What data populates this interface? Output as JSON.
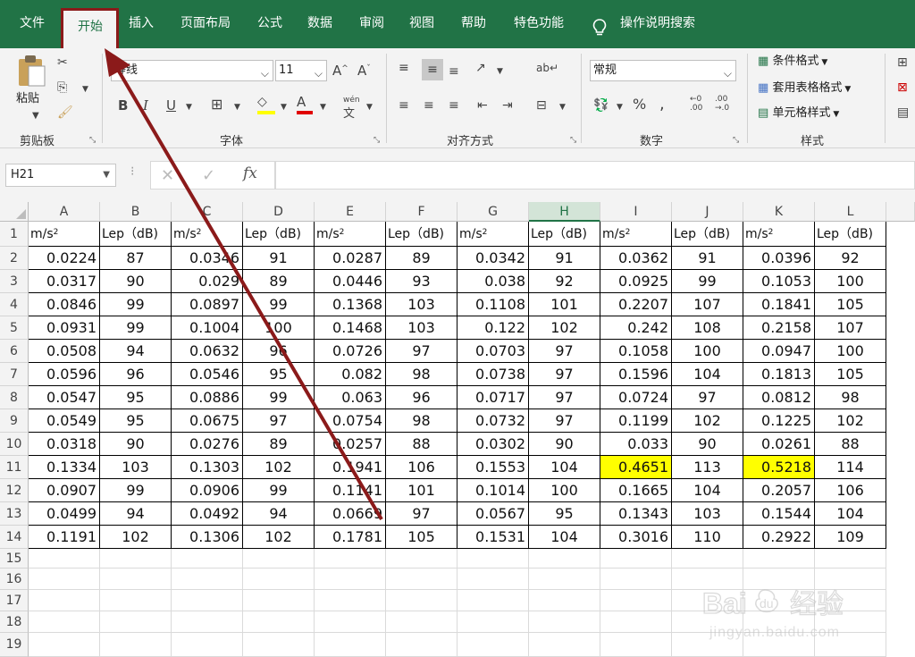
{
  "menu": {
    "items": [
      "文件",
      "开始",
      "插入",
      "页面布局",
      "公式",
      "数据",
      "审阅",
      "视图",
      "帮助",
      "特色功能"
    ],
    "active": "开始",
    "search_label": "操作说明搜索"
  },
  "ribbon": {
    "clipboard": {
      "paste_label": "粘贴",
      "group_label": "剪贴板"
    },
    "font": {
      "font_name": "等线",
      "font_size": "11",
      "bold": "B",
      "italic": "I",
      "underline": "U",
      "phonetic": "wén",
      "group_label": "字体"
    },
    "alignment": {
      "group_label": "对齐方式"
    },
    "number": {
      "format": "常规",
      "group_label": "数字"
    },
    "styles": {
      "conditional": "条件格式",
      "table_format": "套用表格格式",
      "cell_styles": "单元格样式",
      "group_label": "样式"
    }
  },
  "formula_bar": {
    "name_box": "H21",
    "fx": "fx",
    "formula": ""
  },
  "grid": {
    "columns": [
      "A",
      "B",
      "C",
      "D",
      "E",
      "F",
      "G",
      "H",
      "I",
      "J",
      "K",
      "L"
    ],
    "selected_column": "H",
    "rows": [
      "1",
      "2",
      "3",
      "4",
      "5",
      "6",
      "7",
      "8",
      "9",
      "10",
      "11",
      "12",
      "13",
      "14",
      "15",
      "16",
      "17",
      "18",
      "19"
    ],
    "header_accel": "m/s",
    "header_accel_sup": "2",
    "header_lep": "Lep（dB)",
    "data": [
      [
        "0.0224",
        "87",
        "0.0346",
        "91",
        "0.0287",
        "89",
        "0.0342",
        "91",
        "0.0362",
        "91",
        "0.0396",
        "92"
      ],
      [
        "0.0317",
        "90",
        "0.029",
        "89",
        "0.0446",
        "93",
        "0.038",
        "92",
        "0.0925",
        "99",
        "0.1053",
        "100"
      ],
      [
        "0.0846",
        "99",
        "0.0897",
        "99",
        "0.1368",
        "103",
        "0.1108",
        "101",
        "0.2207",
        "107",
        "0.1841",
        "105"
      ],
      [
        "0.0931",
        "99",
        "0.1004",
        "100",
        "0.1468",
        "103",
        "0.122",
        "102",
        "0.242",
        "108",
        "0.2158",
        "107"
      ],
      [
        "0.0508",
        "94",
        "0.0632",
        "96",
        "0.0726",
        "97",
        "0.0703",
        "97",
        "0.1058",
        "100",
        "0.0947",
        "100"
      ],
      [
        "0.0596",
        "96",
        "0.0546",
        "95",
        "0.082",
        "98",
        "0.0738",
        "97",
        "0.1596",
        "104",
        "0.1813",
        "105"
      ],
      [
        "0.0547",
        "95",
        "0.0886",
        "99",
        "0.063",
        "96",
        "0.0717",
        "97",
        "0.0724",
        "97",
        "0.0812",
        "98"
      ],
      [
        "0.0549",
        "95",
        "0.0675",
        "97",
        "0.0754",
        "98",
        "0.0732",
        "97",
        "0.1199",
        "102",
        "0.1225",
        "102"
      ],
      [
        "0.0318",
        "90",
        "0.0276",
        "89",
        "0.0257",
        "88",
        "0.0302",
        "90",
        "0.033",
        "90",
        "0.0261",
        "88"
      ],
      [
        "0.1334",
        "103",
        "0.1303",
        "102",
        "0.1941",
        "106",
        "0.1553",
        "104",
        "0.4651",
        "113",
        "0.5218",
        "114"
      ],
      [
        "0.0907",
        "99",
        "0.0906",
        "99",
        "0.1141",
        "101",
        "0.1014",
        "100",
        "0.1665",
        "104",
        "0.2057",
        "106"
      ],
      [
        "0.0499",
        "94",
        "0.0492",
        "94",
        "0.0669",
        "97",
        "0.0567",
        "95",
        "0.1343",
        "103",
        "0.1544",
        "104"
      ],
      [
        "0.1191",
        "102",
        "0.1306",
        "102",
        "0.1781",
        "105",
        "0.1531",
        "104",
        "0.3016",
        "110",
        "0.2922",
        "109"
      ]
    ],
    "highlighted": [
      {
        "row": "11",
        "col": "I"
      },
      {
        "row": "11",
        "col": "K"
      }
    ]
  },
  "colors": {
    "excel_green": "#217346",
    "highlight": "#ffff00",
    "annotation": "#8b1a1a"
  },
  "watermark": {
    "brand": "Baidu",
    "cn": "经验",
    "url": "jingyan.baidu.com"
  }
}
